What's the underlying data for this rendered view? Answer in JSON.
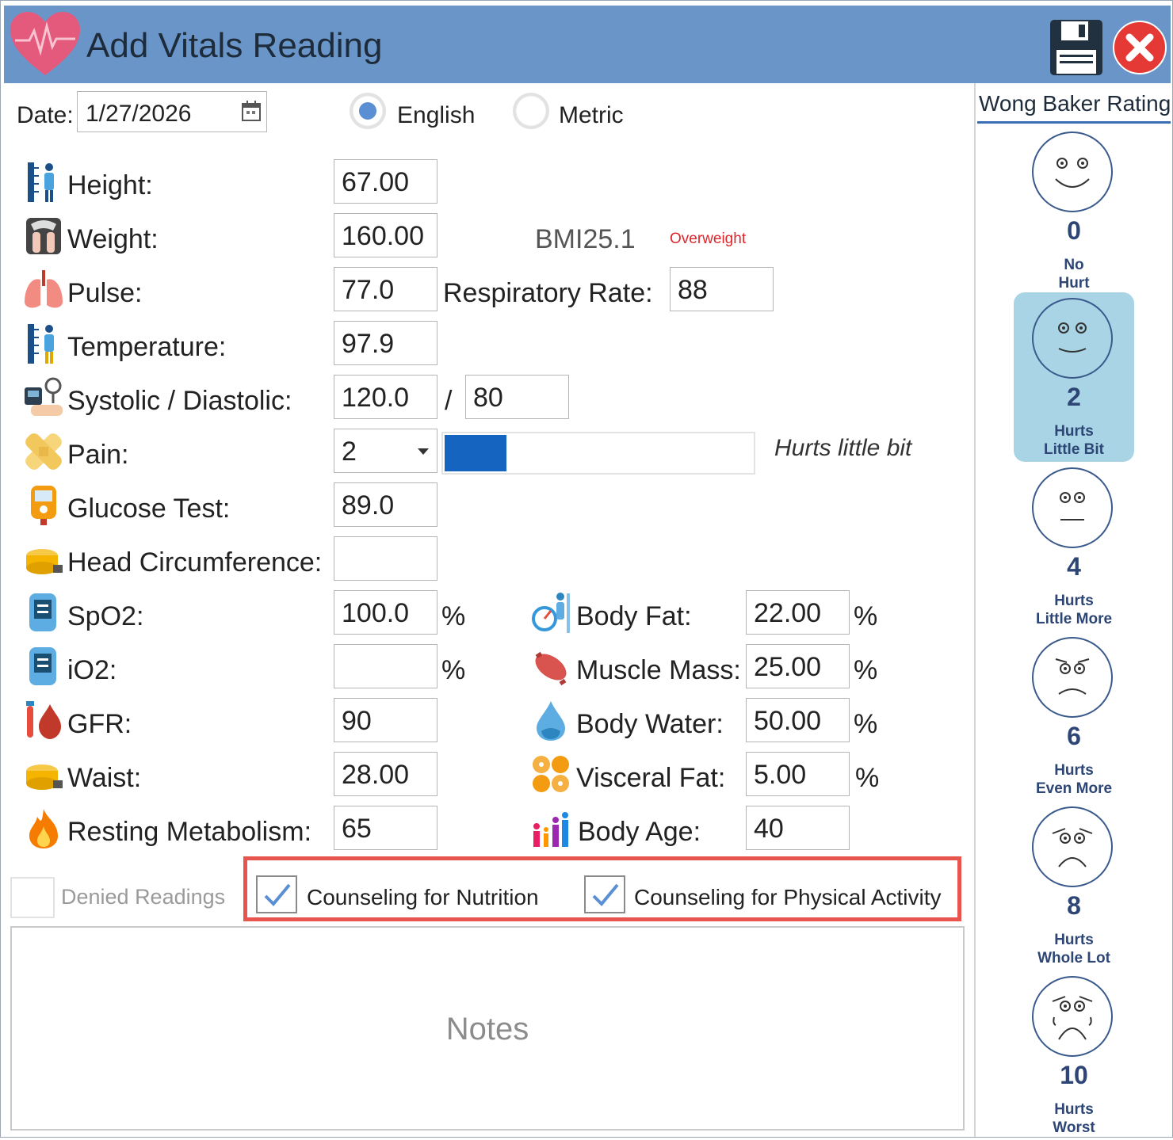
{
  "window": {
    "title": "Add Vitals Reading"
  },
  "date": {
    "label": "Date:",
    "value": "1/27/2026"
  },
  "units": {
    "english": "English",
    "metric": "Metric",
    "selected": "English"
  },
  "labels": {
    "height": "Height:",
    "weight": "Weight:",
    "pulse": "Pulse:",
    "respiratory": "Respiratory Rate:",
    "temperature": "Temperature:",
    "bp": "Systolic / Diastolic:",
    "bp_sep": "/",
    "pain": "Pain:",
    "glucose": "Glucose Test:",
    "head": "Head Circumference:",
    "spo2": "SpO2:",
    "io2": "iO2:",
    "gfr": "GFR:",
    "waist": "Waist:",
    "resting": "Resting Metabolism:",
    "body_fat": "Body Fat:",
    "muscle": "Muscle Mass:",
    "water": "Body Water:",
    "visceral": "Visceral Fat:",
    "body_age": "Body Age:",
    "percent": "%"
  },
  "values": {
    "height": "67.00",
    "weight": "160.00",
    "pulse": "77.0",
    "respiratory": "88",
    "temperature": "97.9",
    "systolic": "120.0",
    "diastolic": "80",
    "pain": "2",
    "glucose": "89.0",
    "head": "",
    "spo2": "100.0",
    "io2": "",
    "gfr": "90",
    "waist": "28.00",
    "resting": "65",
    "body_fat": "22.00",
    "muscle": "25.00",
    "water": "50.00",
    "visceral": "5.00",
    "body_age": "40"
  },
  "bmi": {
    "label": "BMI",
    "value": "25.1",
    "status": "Overweight"
  },
  "pain_meter": {
    "level": 0.2,
    "description": "Hurts little bit"
  },
  "options": {
    "denied": {
      "label": "Denied Readings",
      "checked": false
    },
    "nutrition": {
      "label": "Counseling for Nutrition",
      "checked": true
    },
    "activity": {
      "label": "Counseling for Physical Activity",
      "checked": true
    }
  },
  "notes": {
    "placeholder": "Notes"
  },
  "wong_baker": {
    "title": "Wong Baker Rating",
    "selected": "2",
    "items": [
      {
        "num": "0",
        "line1": "No",
        "line2": "Hurt"
      },
      {
        "num": "2",
        "line1": "Hurts",
        "line2": "Little Bit"
      },
      {
        "num": "4",
        "line1": "Hurts",
        "line2": "Little More"
      },
      {
        "num": "6",
        "line1": "Hurts",
        "line2": "Even More"
      },
      {
        "num": "8",
        "line1": "Hurts",
        "line2": "Whole Lot"
      },
      {
        "num": "10",
        "line1": "Hurts",
        "line2": "Worst"
      }
    ]
  },
  "colors": {
    "titlebar": "#6a95c8",
    "accent": "#1565c0",
    "selected_face": "#a9d4e6",
    "warning": "#e0262b",
    "highlight": "#e8554e"
  }
}
